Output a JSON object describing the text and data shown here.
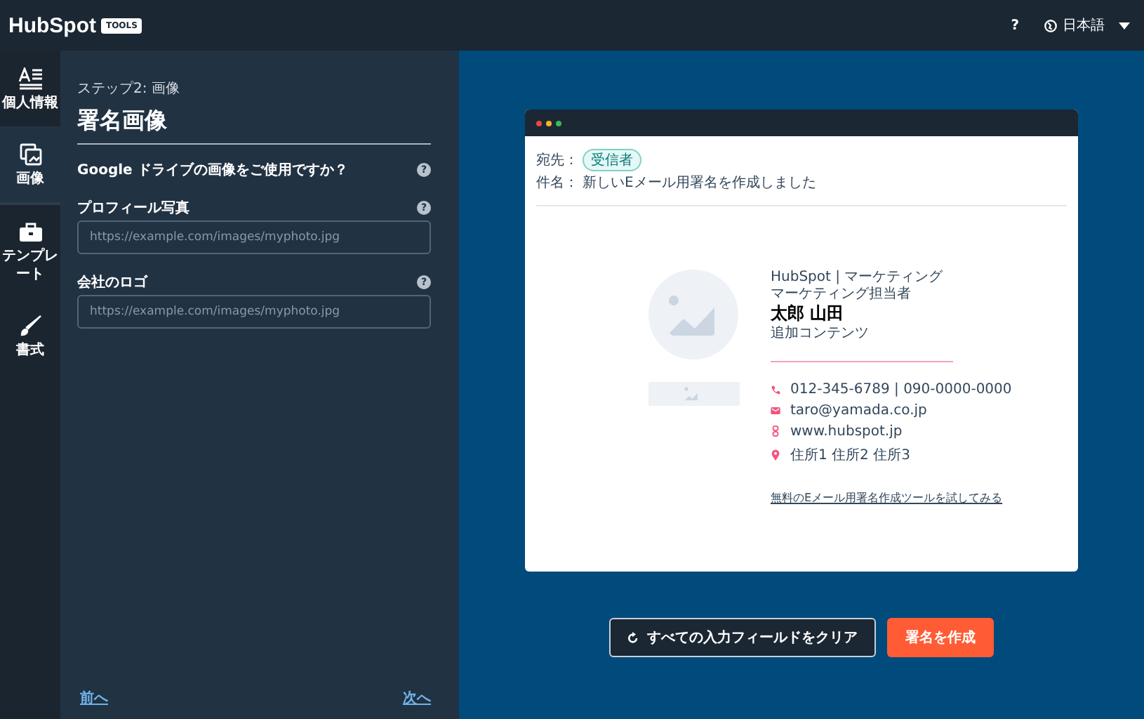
{
  "header": {
    "logo": "HubSpot",
    "badge": "TOOLS",
    "help": "?",
    "language": "日本語"
  },
  "sidebar": {
    "items": [
      {
        "kind": "text",
        "label": "個人情報",
        "selected": false
      },
      {
        "kind": "image",
        "label": "画像",
        "selected": true
      },
      {
        "kind": "template",
        "label": "テンプレート",
        "selected": false
      },
      {
        "kind": "style",
        "label": "書式",
        "selected": false
      }
    ]
  },
  "form": {
    "step": "ステップ2: 画像",
    "title": "署名画像",
    "fields": [
      {
        "kind": "question",
        "label": "Google ドライブの画像をご使用ですか？",
        "help": "?"
      },
      {
        "kind": "input",
        "label": "プロフィール写真",
        "help": "?",
        "placeholder": "https://example.com/images/myphoto.jpg"
      },
      {
        "kind": "input",
        "label": "会社のロゴ",
        "help": "?",
        "placeholder": "https://example.com/images/myphoto.jpg"
      }
    ],
    "prev": "前へ",
    "next": "次へ"
  },
  "preview": {
    "to_label": "宛先：",
    "recipient": "受信者",
    "subject_label": "件名：",
    "subject": "新しいEメール用署名を作成しました",
    "company_line": "HubSpot | マーケティング",
    "job_title": "マーケティング担当者",
    "name": "太郎 山田",
    "extra": "追加コンテンツ",
    "contacts": [
      {
        "kind": "phone",
        "text": "012-345-6789 | 090-0000-0000"
      },
      {
        "kind": "email",
        "text": "taro@yamada.co.jp"
      },
      {
        "kind": "web",
        "text": "www.hubspot.jp"
      },
      {
        "kind": "address",
        "text": "住所1 住所2 住所3"
      }
    ],
    "link": "無料のEメール用署名作成ツールを試してみる"
  },
  "actions": {
    "clear": "すべての入力フィールドをクリア",
    "create": "署名を作成"
  }
}
